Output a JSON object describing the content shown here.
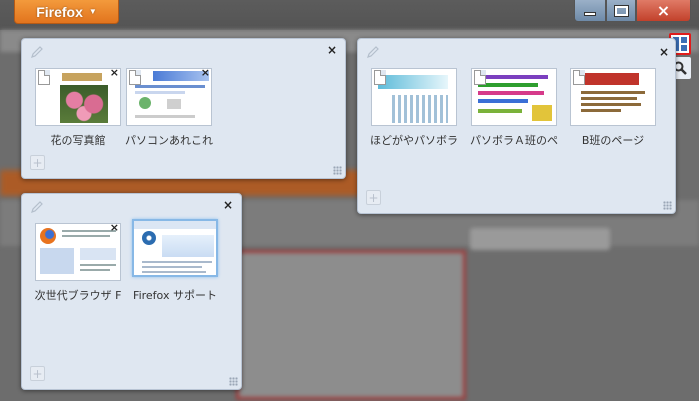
{
  "app": {
    "menu_button_label": "Firefox",
    "window_controls": {
      "minimize": "minimize-icon",
      "maximize": "maximize-icon",
      "close": "×"
    }
  },
  "panorama": {
    "side_buttons": [
      {
        "name": "tab-groups-icon",
        "selected": true
      },
      {
        "name": "search-icon",
        "glyph": "🔍"
      }
    ],
    "groups": [
      {
        "id": "group-1",
        "close": "×",
        "tabs": [
          {
            "title": "花の写真館",
            "close": "×",
            "thumb": "flower"
          },
          {
            "title": "パソコンあれこれ",
            "close": "×",
            "thumb": "pc"
          }
        ]
      },
      {
        "id": "group-2",
        "close": "×",
        "tabs": [
          {
            "title": "ほどがやパソボラ",
            "thumb": "cyan"
          },
          {
            "title": "パソボラＡ班のペ",
            "thumb": "multi"
          },
          {
            "title": "B班のページ",
            "thumb": "yellow"
          }
        ]
      },
      {
        "id": "group-3",
        "close": "×",
        "tabs": [
          {
            "title": "次世代ブラウザ F",
            "close": "×",
            "thumb": "ff"
          },
          {
            "title": "Firefox サポート",
            "thumb": "support",
            "selected": true
          }
        ]
      }
    ],
    "new_tab_glyph": "+"
  },
  "colors": {
    "accent_orange": "#e2741d",
    "group_background": "#dfe7f1",
    "highlight_red": "#e01b1b"
  }
}
